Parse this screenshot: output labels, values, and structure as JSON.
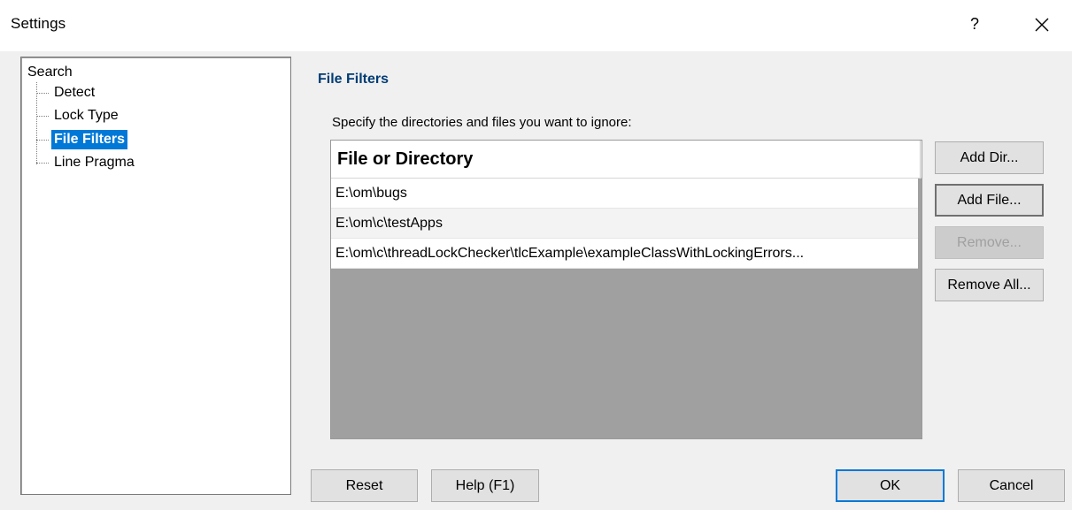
{
  "window": {
    "title": "Settings",
    "help_glyph": "?",
    "close_icon": "close-icon"
  },
  "tree": {
    "root": "Search",
    "items": [
      {
        "label": "Detect",
        "selected": false
      },
      {
        "label": "Lock Type",
        "selected": false
      },
      {
        "label": "File Filters",
        "selected": true
      },
      {
        "label": "Line Pragma",
        "selected": false
      }
    ]
  },
  "panel": {
    "title": "File Filters",
    "instruction": "Specify the directories and files you want to ignore:"
  },
  "list": {
    "column_header": "File or Directory",
    "rows": [
      "E:\\om\\bugs",
      "E:\\om\\c\\testApps",
      "E:\\om\\c\\threadLockChecker\\tlcExample\\exampleClassWithLockingErrors..."
    ]
  },
  "side_buttons": {
    "add_dir": "Add Dir...",
    "add_file": "Add File...",
    "remove": "Remove...",
    "remove_all": "Remove All..."
  },
  "bottom_buttons": {
    "reset": "Reset",
    "help": "Help (F1)",
    "ok": "OK",
    "cancel": "Cancel"
  },
  "colors": {
    "accent": "#0078d7",
    "section_title": "#003c74",
    "list_empty_area": "#a0a0a0"
  }
}
